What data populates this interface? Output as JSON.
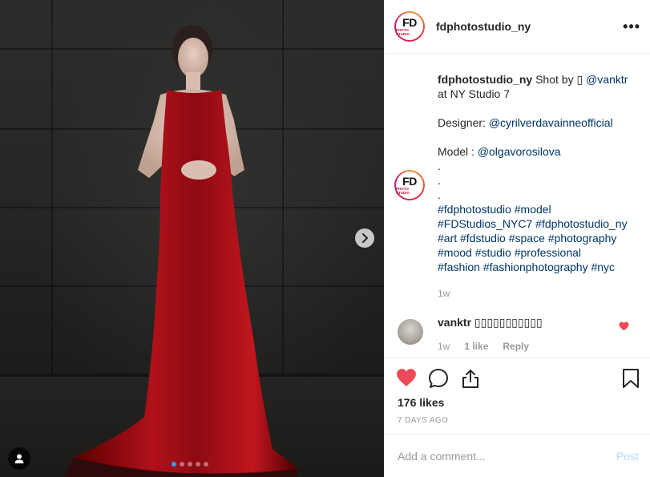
{
  "post": {
    "username": "fdphotostudio_ny",
    "logo": {
      "main": "FD",
      "sub": "PHOTO STUDIO"
    },
    "more_label": "•••",
    "caption": {
      "username": "fdphotostudio_ny",
      "text_1": "Shot by",
      "camera_glyph": "▯",
      "mention_photographer": "@vanktr",
      "text_2": "at NY Studio 7",
      "designer_label": "Designer:",
      "mention_designer": "@cyrilverdavainneofficial",
      "model_label": "Model :",
      "mention_model": "@olgavorosilova",
      "dots": [
        ".",
        ".",
        "."
      ],
      "hashtags": [
        "#fdphotostudio #model",
        "#FDStudios_NYC7 #fdphotostudio_ny",
        "#art #fdstudio #space #photography",
        "#mood #studio #professional",
        "#fashion #fashionphotography #nyc"
      ],
      "time": "1w"
    },
    "reply": {
      "username": "vanktr",
      "text": "▯▯▯▯▯▯▯▯▯▯▯",
      "time": "1w",
      "likes": "1 like",
      "reply_label": "Reply",
      "heart_color": "#ed4956"
    },
    "likes": "176 likes",
    "date": "7 DAYS AGO",
    "comment": {
      "placeholder": "Add a comment...",
      "post_label": "Post"
    },
    "carousel": {
      "count": 5,
      "active": 0
    },
    "icons": {
      "like": "heart-filled-icon",
      "comment": "comment-bubble-icon",
      "share": "share-icon",
      "save": "bookmark-icon",
      "next": "chevron-right-icon",
      "user_tag": "person-icon"
    },
    "colors": {
      "like": "#ed4956",
      "link": "#003569",
      "accent": "#3897f0"
    }
  }
}
